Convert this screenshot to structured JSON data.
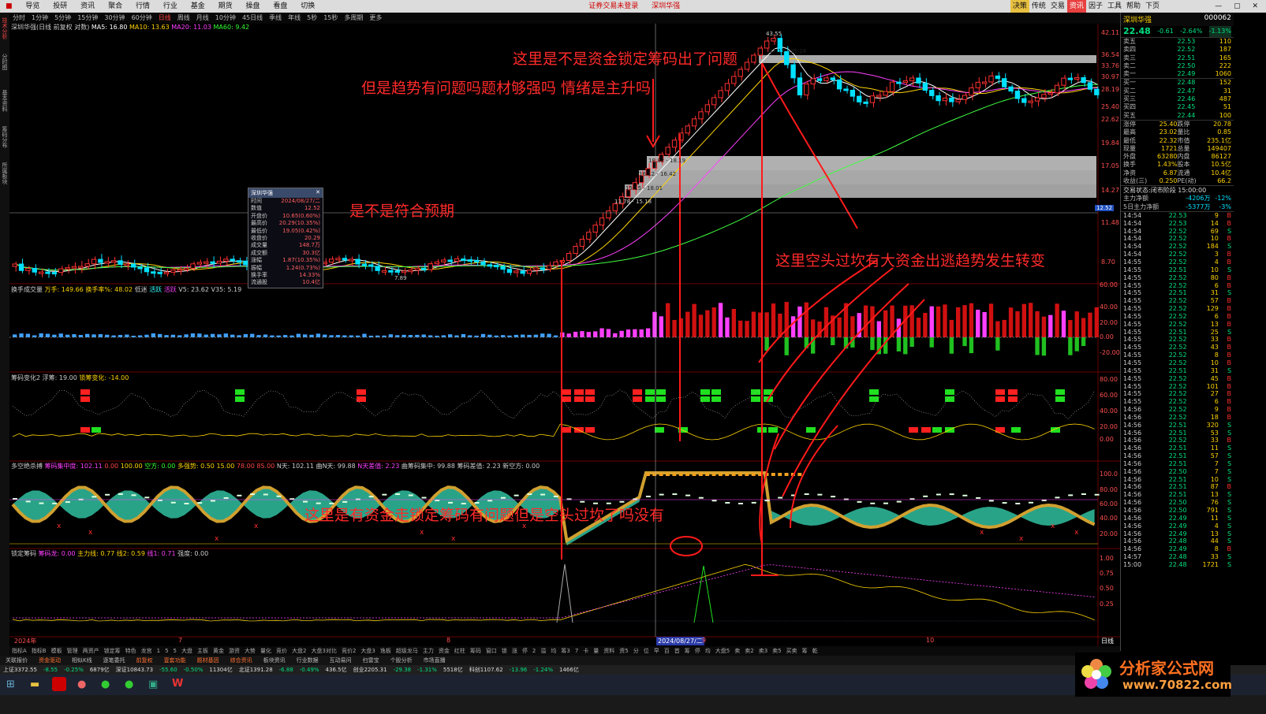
{
  "menu": {
    "items": [
      "导览",
      "投研",
      "资讯",
      "聚合",
      "行情",
      "行业",
      "基金",
      "期货",
      "操盘",
      "看盘",
      "切换"
    ],
    "center": "证券交易未登录",
    "center2": "深圳华强",
    "right": [
      "决策",
      "传统",
      "交易",
      "资讯",
      "因子",
      "工具",
      "帮助",
      "下页"
    ]
  },
  "periods": [
    "分时",
    "1分钟",
    "5分钟",
    "15分钟",
    "30分钟",
    "60分钟",
    "日线",
    "周线",
    "月线",
    "10分钟",
    "45日线",
    "季线",
    "年线",
    "5秒",
    "15秒",
    "多周期",
    "更多"
  ],
  "period_selected": "日线",
  "main_title": {
    "name": "深圳华强(日线 前复权 对数)",
    "ma5": "MA5: 16.80",
    "ma10": "MA10: 13.63",
    "ma20": "MA20: 11.03",
    "ma60": "MA60: 9.42"
  },
  "price_axis": [
    "42.11",
    "36.54",
    "33.76",
    "30.97",
    "28.19",
    "25.40",
    "22.62",
    "19.84",
    "17.05",
    "14.27",
    "11.48",
    "8.70"
  ],
  "price_axis_marker": "12.52",
  "price_labels": {
    "peak": "43.55",
    "range1": "37.15 - 35.24",
    "range2": "18.82 - 18.19",
    "range3": "16.12 - 16.42",
    "range4": "15.15 - 18.01",
    "range5": "13.78 - 15.18",
    "low": "7.89"
  },
  "infobox": {
    "title": "深圳华强",
    "rows": [
      [
        "时间",
        "2024/08/27/二"
      ],
      [
        "数值",
        "12.52"
      ],
      [
        "开盘价",
        "10.65(0.60%)"
      ],
      [
        "最高价",
        "20.29(10.35%)"
      ],
      [
        "最低价",
        "19.05(0.42%)"
      ],
      [
        "收盘价",
        "20.29"
      ],
      [
        "成交量",
        "148.7万"
      ],
      [
        "成交额",
        "30.3亿"
      ],
      [
        "涨幅",
        "1.87(10.35%)"
      ],
      [
        "振幅",
        "1.24(0.73%)"
      ],
      [
        "换手率",
        "14.33%"
      ],
      [
        "流通股",
        "10.4亿"
      ]
    ]
  },
  "panel2_title": {
    "name": "换手成交量",
    "a": "万手: 149.66",
    "b": "换手率%: 48.02",
    "c": "低迷",
    "d": "活跃",
    "e": "活跃",
    "f": "V5: 23.62",
    "g": "V35: 5.19"
  },
  "panel2_axis": [
    "60.00",
    "40.00",
    "20.00",
    "0.00",
    "-20.00"
  ],
  "panel3_title": {
    "name": "筹码变化2",
    "a": "浮筹: 19.00",
    "b": "锁筹变化: -14.00"
  },
  "panel3_axis": [
    "80.00",
    "60.00",
    "40.00",
    "20.00",
    "0.00"
  ],
  "panel4_title": {
    "name": "多空绝杀搏",
    "a": "筹码集中度: 102.11",
    "b": "0.00",
    "c": "100.00",
    "d": "空方: 0.00",
    "e": "多强势: 0.50",
    "f": "15.00",
    "g": "78.00",
    "h": "85.00",
    "i": "N天: 102.11",
    "j": "曲N天: 99.88",
    "k": "N天差值: 2.23",
    "l": "曲筹码集中: 99.88",
    "m": "筹码差值: 2.23",
    "n": "新空方: 0.00"
  },
  "panel4_axis": [
    "100.0",
    "80.00",
    "60.00",
    "40.00",
    "20.00"
  ],
  "panel5_title": {
    "name": "锁定筹码",
    "a": "筹码龙: 0.00",
    "b": "主力线: 0.77",
    "c": "线2: 0.59",
    "d": "线1: 0.71",
    "e": "强度: 0.00"
  },
  "panel5_axis": [
    "1.00",
    "0.75",
    "0.50",
    "0.25"
  ],
  "date_axis": {
    "d1": "2024年",
    "d2": "7",
    "d3": "8",
    "d4": "2024/08/27/二",
    "d5": "9",
    "d6": "10",
    "d7": "日线"
  },
  "annotations": {
    "a1": "这里是不是资金锁定筹码出了问题",
    "a2": "但是趋势有问题吗题材够强吗 情绪是主升吗",
    "a3": "是不是符合预期",
    "a4": "这里空头过坎有大资金出逃趋势发生转变",
    "a5": "这里是有资金走锁定筹码有问题但是空头过坎了吗没有"
  },
  "quote": {
    "name": "深圳华强",
    "code": "000062",
    "price": "22.48",
    "change": "-0.61",
    "pct": "-2.64%",
    "pct2": "-1.13%",
    "asks": [
      [
        "卖五",
        "22.53",
        "110"
      ],
      [
        "卖四",
        "22.52",
        "187"
      ],
      [
        "卖三",
        "22.51",
        "165"
      ],
      [
        "卖二",
        "22.50",
        "222"
      ],
      [
        "卖一",
        "22.49",
        "1060"
      ]
    ],
    "bids": [
      [
        "买一",
        "22.48",
        "152"
      ],
      [
        "买二",
        "22.47",
        "31"
      ],
      [
        "买三",
        "22.46",
        "487"
      ],
      [
        "买四",
        "22.45",
        "51"
      ],
      [
        "买五",
        "22.44",
        "100"
      ]
    ],
    "stats": [
      [
        "涨停",
        "25.40",
        "跌停",
        "20.78"
      ],
      [
        "最高",
        "23.02",
        "量比",
        "0.85"
      ],
      [
        "最低",
        "22.32",
        "市值",
        "235.1亿"
      ],
      [
        "现量",
        "1721",
        "总量",
        "149407"
      ],
      [
        "外盘",
        "63280",
        "内盘",
        "86127"
      ],
      [
        "换手",
        "1.43%",
        "股本",
        "10.5亿"
      ],
      [
        "净资",
        "6.87",
        "流通",
        "10.4亿"
      ],
      [
        "收益(三)",
        "0.250",
        "PE(动)",
        "66.2"
      ]
    ],
    "status": "交易状态:闭市阶段 15:00:00",
    "flow": [
      [
        "主力净额",
        "-4206万",
        "-12%"
      ],
      [
        "5日主力净额",
        "-5377万",
        "-3%"
      ]
    ]
  },
  "ticks": [
    [
      "14:54",
      "22.53",
      "9",
      "B"
    ],
    [
      "14:54",
      "22.53",
      "14",
      "B"
    ],
    [
      "14:54",
      "22.52",
      "69",
      "S"
    ],
    [
      "14:54",
      "22.52",
      "10",
      "B"
    ],
    [
      "14:54",
      "22.52",
      "184",
      "S"
    ],
    [
      "14:54",
      "22.52",
      "3",
      "B"
    ],
    [
      "14:55",
      "22.52",
      "4",
      "B"
    ],
    [
      "14:55",
      "22.51",
      "10",
      "S"
    ],
    [
      "14:55",
      "22.52",
      "80",
      "B"
    ],
    [
      "14:55",
      "22.52",
      "6",
      "B"
    ],
    [
      "14:55",
      "22.51",
      "31",
      "S"
    ],
    [
      "14:55",
      "22.52",
      "57",
      "B"
    ],
    [
      "14:55",
      "22.52",
      "129",
      "B"
    ],
    [
      "14:55",
      "22.52",
      "6",
      "B"
    ],
    [
      "14:55",
      "22.52",
      "13",
      "B"
    ],
    [
      "14:55",
      "22.51",
      "25",
      "S"
    ],
    [
      "14:55",
      "22.52",
      "33",
      "B"
    ],
    [
      "14:55",
      "22.52",
      "43",
      "B"
    ],
    [
      "14:55",
      "22.52",
      "8",
      "B"
    ],
    [
      "14:55",
      "22.52",
      "10",
      "B"
    ],
    [
      "14:55",
      "22.51",
      "31",
      "S"
    ],
    [
      "14:55",
      "22.52",
      "45",
      "B"
    ],
    [
      "14:55",
      "22.52",
      "101",
      "B"
    ],
    [
      "14:55",
      "22.52",
      "27",
      "B"
    ],
    [
      "14:55",
      "22.52",
      "6",
      "B"
    ],
    [
      "14:56",
      "22.52",
      "9",
      "B"
    ],
    [
      "14:56",
      "22.52",
      "18",
      "B"
    ],
    [
      "14:56",
      "22.51",
      "320",
      "S"
    ],
    [
      "14:56",
      "22.51",
      "53",
      "S"
    ],
    [
      "14:56",
      "22.52",
      "33",
      "B"
    ],
    [
      "14:56",
      "22.51",
      "11",
      "S"
    ],
    [
      "14:56",
      "22.51",
      "57",
      "S"
    ],
    [
      "14:56",
      "22.51",
      "7",
      "S"
    ],
    [
      "14:56",
      "22.50",
      "7",
      "S"
    ],
    [
      "14:56",
      "22.51",
      "10",
      "S"
    ],
    [
      "14:56",
      "22.51",
      "87",
      "B"
    ],
    [
      "14:56",
      "22.51",
      "13",
      "S"
    ],
    [
      "14:56",
      "22.50",
      "76",
      "S"
    ],
    [
      "14:56",
      "22.50",
      "791",
      "S"
    ],
    [
      "14:56",
      "22.49",
      "11",
      "S"
    ],
    [
      "14:56",
      "22.49",
      "4",
      "S"
    ],
    [
      "14:56",
      "22.49",
      "13",
      "S"
    ],
    [
      "14:56",
      "22.48",
      "44",
      "S"
    ],
    [
      "14:56",
      "22.49",
      "8",
      "B"
    ],
    [
      "14:57",
      "22.48",
      "33",
      "S"
    ],
    [
      "15:00",
      "22.48",
      "1721",
      "S"
    ]
  ],
  "bottom_tabs": [
    "指标A",
    "指标B",
    "模板",
    "管理",
    "两资产",
    "锁定筹",
    "特色",
    "龙宫",
    "1",
    "5",
    "5",
    "大盘",
    "主板",
    "黄金",
    "游资",
    "大势",
    "量化",
    "竞价",
    "大盘2",
    "大盘3对比",
    "竞价2",
    "大盘3",
    "逸板",
    "超级龙马",
    "主力",
    "资金",
    "红柱",
    "筹码",
    "窗口",
    "锁",
    "涨",
    "停",
    "2",
    "溢",
    "均",
    "筹3",
    "7",
    "卡",
    "量",
    "资料",
    "资5",
    "分",
    "位",
    "早",
    "百",
    "首",
    "筹",
    "停",
    "均",
    "大盘5",
    "卖",
    "卖2",
    "卖3",
    "卖5",
    "买卖",
    "筹",
    "乾"
  ],
  "bottom_tabs2": [
    "关联报价",
    "资金驱动",
    "相似K线",
    "逐笔委托",
    "前复权",
    "壹套功能",
    "题材基因",
    "综合资讯",
    "板块资讯",
    "行业数据",
    "互动易问",
    "扫雷宝",
    "个股分析",
    "市场直播"
  ],
  "status": [
    "上证3372.55",
    "-8.55",
    "-0.25%",
    "6879亿",
    "深证10843.73",
    "-55.60",
    "-0.50%",
    "11304亿",
    "北证1391.28",
    "-6.88",
    "-0.49%",
    "436.5亿",
    "创业2205.31",
    "-29.38",
    "-1.31%",
    "5518亿",
    "科创1107.62",
    "-13.96",
    "-1.24%",
    "1466亿"
  ],
  "logo": {
    "brand": "分析家公式网",
    "url": "www.70822.com"
  },
  "colors": {
    "up": "#ff3030",
    "down": "#00e0ff",
    "ma5": "#ffffff",
    "ma10": "#ffd400",
    "ma20": "#ff40ff",
    "ma60": "#40ff40",
    "annotation": "#ff2a2a"
  }
}
